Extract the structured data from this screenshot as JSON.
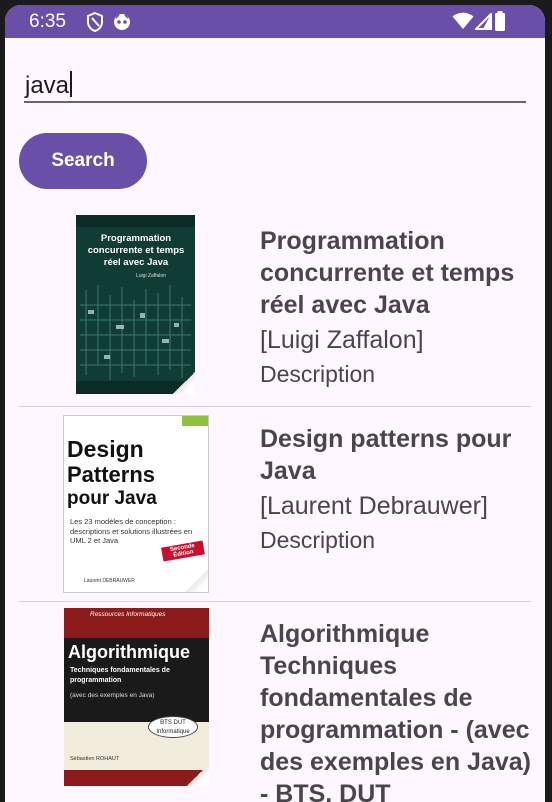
{
  "status_bar": {
    "time": "6:35",
    "background_color": "#6a4fa8",
    "icons": [
      "shield-icon",
      "face-icon",
      "wifi-icon",
      "signal-icon",
      "battery-icon"
    ]
  },
  "search": {
    "value": "java",
    "button_label": "Search"
  },
  "books": [
    {
      "title": "Programmation concurrente et temps réel avec Java",
      "author": "[Luigi Zaffalon]",
      "description": "Description",
      "cover": {
        "title_text": "Programmation concurrente et temps réel avec Java",
        "author_text": "Luigi Zaffalon",
        "bg_color": "#0f3d36"
      }
    },
    {
      "title": "Design patterns pour Java",
      "author": "[Laurent Debrauwer]",
      "description": "Description",
      "cover": {
        "title_line1": "Design",
        "title_line2": "Patterns",
        "title_line3": "pour Java",
        "subtitle": "Les 23 modèles de conception : descriptions et solutions illustrées en UML 2 et Java",
        "badge": "Seconde Édition",
        "author_text": "Laurent DEBRAUWER",
        "bg_color": "#ffffff"
      }
    },
    {
      "title": "Algorithmique Techniques fondamentales de programmation - (avec des exemples en Java) - BTS, DUT",
      "author": "",
      "description": "",
      "cover": {
        "series": "Ressources Informatiques",
        "title_text": "Algorithmique",
        "subtitle": "Techniques fondamentales de programmation",
        "note": "(avec des exemples en Java)",
        "badge": "BTS DUT Informatique",
        "author_text": "Sébastien ROHAUT",
        "bg_color": "#8b1a1a"
      }
    }
  ]
}
